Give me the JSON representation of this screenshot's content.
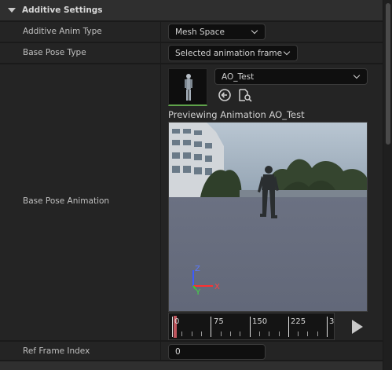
{
  "section": {
    "title": "Additive Settings"
  },
  "rows": {
    "anim_type": {
      "label": "Additive Anim Type",
      "value": "Mesh Space"
    },
    "base_pose_type": {
      "label": "Base Pose Type",
      "value": "Selected animation frame"
    },
    "base_pose_anim": {
      "label": "Base Pose Animation",
      "asset": "AO_Test",
      "preview_label": "Previewing Animation AO_Test"
    },
    "ref_frame": {
      "label": "Ref Frame Index",
      "value": "0"
    }
  },
  "timeline": {
    "ticks": [
      "0",
      "75",
      "150",
      "225",
      "3"
    ]
  },
  "axes": {
    "z": "Z",
    "y": "Y",
    "x": "X"
  },
  "icons": {
    "collapse": "caret-down-icon",
    "use_selected": "arrow-left-circle-icon",
    "browse": "browse-asset-icon",
    "play": "play-icon"
  },
  "colors": {
    "accent_green": "#5fa34a",
    "scrub_marker": "#c0565e"
  }
}
